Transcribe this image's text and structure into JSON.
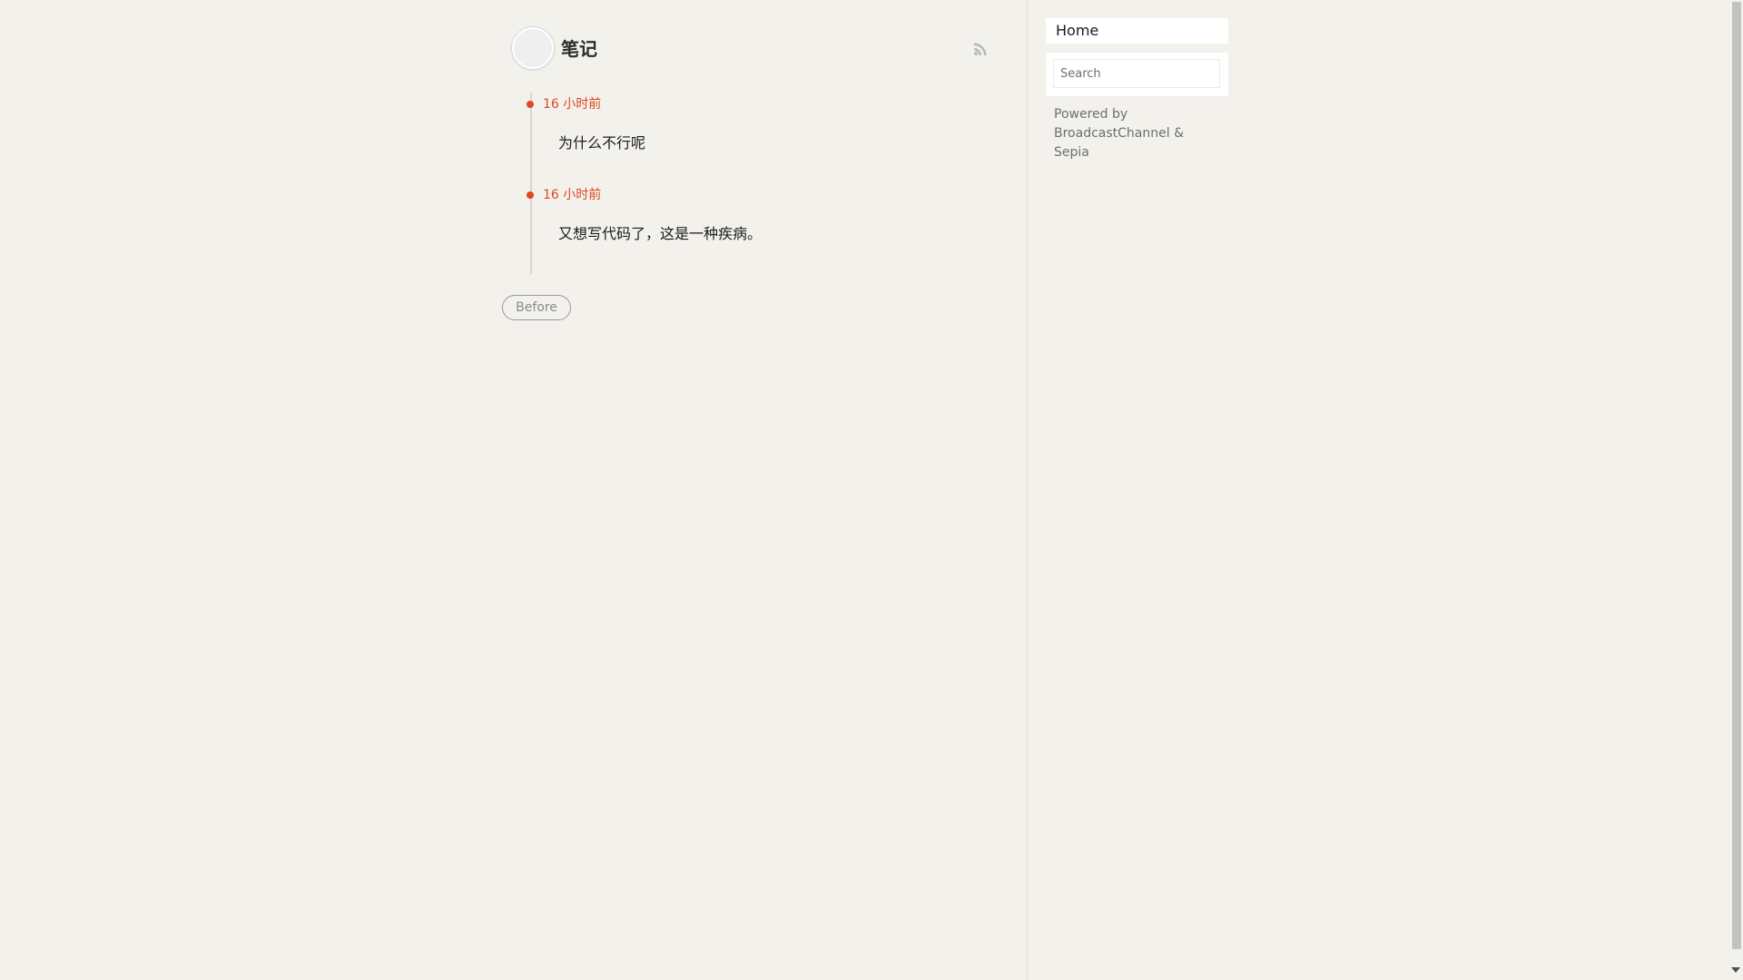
{
  "channel": {
    "title": "笔记"
  },
  "icons": {
    "avatar": "avatar",
    "rss": "rss-icon"
  },
  "posts": [
    {
      "time": "16 小时前",
      "text": "为什么不行呢"
    },
    {
      "time": "16 小时前",
      "text": "又想写代码了，这是一种疾病。"
    }
  ],
  "pagination": {
    "before_label": "Before"
  },
  "sidebar": {
    "home_label": "Home",
    "search": {
      "placeholder": "Search",
      "value": ""
    },
    "powered_by": {
      "prefix": "Powered by",
      "link1": "BroadcastChannel",
      "separator": "&",
      "link2": "Sepia"
    }
  },
  "colors": {
    "background": "#f3f1ec",
    "accent": "#e0461f",
    "muted_text": "#6e6e6e"
  }
}
